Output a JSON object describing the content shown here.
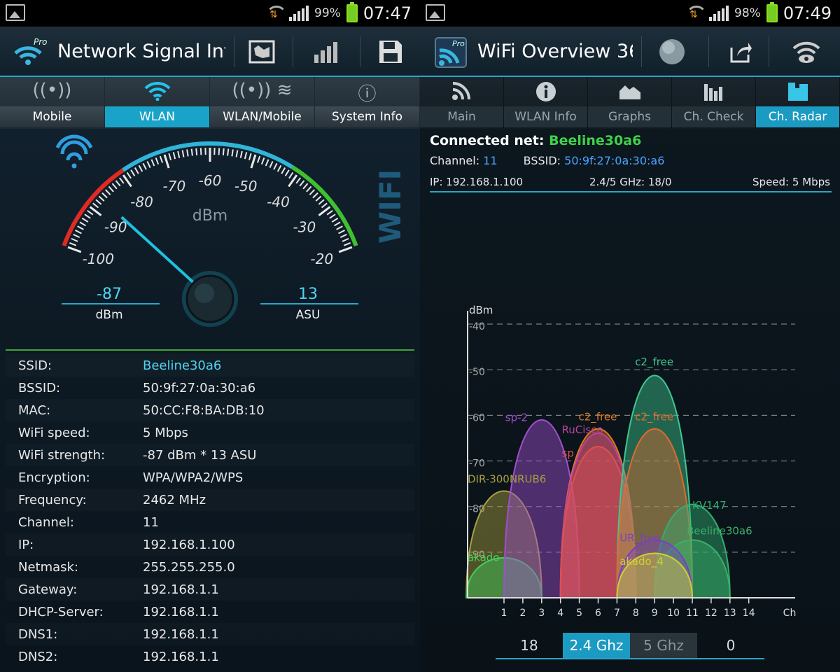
{
  "left": {
    "status": {
      "battery": "99%",
      "time": "07:47"
    },
    "title": "Network Signal Inf",
    "toolbar": {
      "map_icon": "map-icon",
      "bars_icon": "signal-bars-icon",
      "save_icon": "save-icon"
    },
    "tabs": [
      {
        "label": "Mobile",
        "icon": "antenna-icon"
      },
      {
        "label": "WLAN",
        "icon": "wifi-icon"
      },
      {
        "label": "WLAN/Mobile",
        "icon": "antenna-wifi-icon"
      },
      {
        "label": "System Info",
        "icon": "info-icon"
      }
    ],
    "gauge": {
      "unit": "dBm",
      "side_label": "WIFI",
      "ticks": [
        "-100",
        "-90",
        "-80",
        "-70",
        "-60",
        "-50",
        "-40",
        "-30",
        "-20"
      ],
      "value_dbm": "-87",
      "value_dbm_unit": "dBm",
      "value_asu": "13",
      "value_asu_unit": "ASU",
      "needle_value": -87
    },
    "info": [
      {
        "label": "SSID:",
        "value": "Beeline30a6",
        "cyan": true
      },
      {
        "label": "BSSID:",
        "value": "50:9f:27:0a:30:a6"
      },
      {
        "label": "MAC:",
        "value": "50:CC:F8:BA:DB:10"
      },
      {
        "label": "WiFi speed:",
        "value": "5 Mbps"
      },
      {
        "label": "WiFi strength:",
        "value": "-87 dBm * 13 ASU"
      },
      {
        "label": "Encryption:",
        "value": "WPA/WPA2/WPS"
      },
      {
        "label": "Frequency:",
        "value": "2462 MHz"
      },
      {
        "label": "Channel:",
        "value": "11"
      },
      {
        "label": "IP:",
        "value": "192.168.1.100"
      },
      {
        "label": "Netmask:",
        "value": "255.255.255.0"
      },
      {
        "label": "Gateway:",
        "value": "192.168.1.1"
      },
      {
        "label": "DHCP-Server:",
        "value": "192.168.1.1"
      },
      {
        "label": "DNS1:",
        "value": "192.168.1.1"
      },
      {
        "label": "DNS2:",
        "value": "192.168.1.1"
      }
    ]
  },
  "right": {
    "status": {
      "battery": "98%",
      "time": "07:49"
    },
    "title": "WiFi Overview 36",
    "tabs": [
      {
        "label": "Main",
        "icon": "rss-icon"
      },
      {
        "label": "WLAN Info",
        "icon": "info-icon"
      },
      {
        "label": "Graphs",
        "icon": "area-graph-icon"
      },
      {
        "label": "Ch. Check",
        "icon": "bar-graph-icon"
      },
      {
        "label": "Ch. Radar",
        "icon": "radar-icon"
      }
    ],
    "connected_label": "Connected net:",
    "connected_ssid": "Beeline30a6",
    "channel_label": "Channel:",
    "channel_value": "11",
    "bssid_label": "BSSID:",
    "bssid_value": "50:9f:27:0a:30:a6",
    "ip_text": "IP: 192.168.1.100",
    "band_text": "2.4/5 GHz: 18/0",
    "speed_text": "Speed: 5 Mbps",
    "segment": {
      "left_count": "18",
      "band24": "2.4 Ghz",
      "band5": "5 Ghz",
      "right_count": "0"
    }
  },
  "chart_data": {
    "type": "area",
    "ylabel": "dBm",
    "xlabel": "Ch",
    "y_ticks": [
      "-40",
      "-50",
      "-60",
      "-70",
      "-80",
      "-90"
    ],
    "ylim": [
      -100,
      -38
    ],
    "x_ticks": [
      "1",
      "2",
      "3",
      "4",
      "5",
      "6",
      "7",
      "8",
      "9",
      "10",
      "11",
      "12",
      "13",
      "14"
    ],
    "series": [
      {
        "name": "DIR-300NRUB6",
        "channel": 1,
        "dbm": -76,
        "color": "#a8a040"
      },
      {
        "name": "akado",
        "channel": 1,
        "dbm": -91,
        "color": "#3fcf5a"
      },
      {
        "name": "sp-2",
        "channel": 3,
        "dbm": -60,
        "color": "#a04ed0"
      },
      {
        "name": "c2_free",
        "channel": 6,
        "dbm": -62,
        "color": "#e07a20"
      },
      {
        "name": "RuCisco",
        "channel": 6,
        "dbm": -63,
        "color": "#c040a0"
      },
      {
        "name": "sp",
        "channel": 6,
        "dbm": -66,
        "color": "#e05050"
      },
      {
        "name": "c2_free",
        "channel": 9,
        "dbm": -50,
        "color": "#3ec890"
      },
      {
        "name": "c2_free",
        "channel": 9,
        "dbm": -62,
        "color": "#e06a30"
      },
      {
        "name": "KV147",
        "channel": 11,
        "dbm": -79,
        "color": "#30b070"
      },
      {
        "name": "Beeline30a6",
        "channel": 11,
        "dbm": -87,
        "color": "#3ab068"
      },
      {
        "name": "UR_free",
        "channel": 9,
        "dbm": -87,
        "color": "#7a40c0"
      },
      {
        "name": "akado_4",
        "channel": 9,
        "dbm": -90,
        "color": "#d0d030"
      }
    ]
  }
}
